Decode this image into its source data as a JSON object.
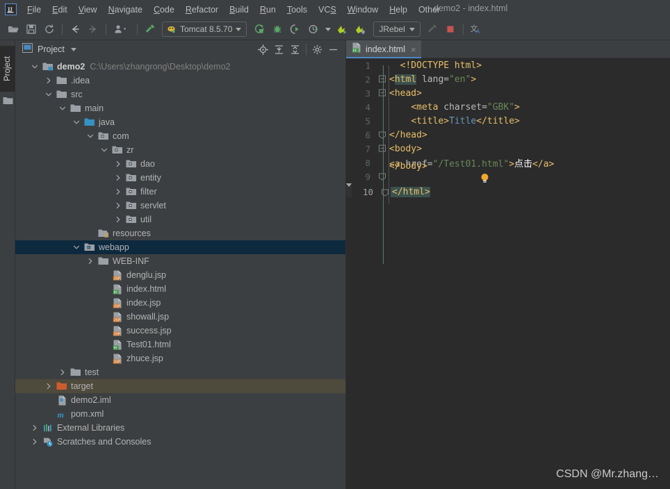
{
  "window": {
    "title": "demo2 - index.html",
    "logo_text": "IJ"
  },
  "menubar": {
    "items": [
      {
        "label": "File",
        "mnemonic": "F"
      },
      {
        "label": "Edit",
        "mnemonic": "E"
      },
      {
        "label": "View",
        "mnemonic": "V"
      },
      {
        "label": "Navigate",
        "mnemonic": "N"
      },
      {
        "label": "Code",
        "mnemonic": "C"
      },
      {
        "label": "Refactor",
        "mnemonic": "R"
      },
      {
        "label": "Build",
        "mnemonic": "B"
      },
      {
        "label": "Run",
        "mnemonic": "R"
      },
      {
        "label": "Tools",
        "mnemonic": "T"
      },
      {
        "label": "VCS",
        "mnemonic": "S"
      },
      {
        "label": "Window",
        "mnemonic": "W"
      },
      {
        "label": "Help",
        "mnemonic": "H"
      },
      {
        "label": "Other",
        "mnemonic": ""
      }
    ]
  },
  "toolbar": {
    "icons": [
      "open-folder-icon",
      "save-all-icon",
      "sync-refresh-icon",
      "navigate-back-icon",
      "navigate-forward-icon",
      "profile-dropdown-icon",
      "build-hammer-icon"
    ],
    "run_config": "Tomcat 8.5.70",
    "run_icons": [
      "run-icon",
      "debug-icon",
      "run-with-coverage-icon",
      "profiler-icon"
    ],
    "jrebel_run_icon": "jrebel-run-icon",
    "jrebel_debug_icon": "jrebel-debug-icon",
    "jrebel_label": "JRebel",
    "stop_icon": "stop-icon",
    "hammer_grey_icon": "hammer-grey-icon",
    "translate_icon": "translate-icon"
  },
  "left_strip": {
    "tool_label": "Project",
    "folder_icon": "folder-icon"
  },
  "project_panel": {
    "title": "Project",
    "buttons": [
      "locate-target-icon",
      "expand-all-icon",
      "collapse-all-icon",
      "settings-gear-icon",
      "hide-panel-icon"
    ],
    "tree": [
      {
        "label": "demo2",
        "path": "C:\\Users\\zhangrong\\Desktop\\demo2",
        "depth": 0,
        "arrow": "down",
        "icon": "module-folder-icon",
        "bold": true,
        "state": "normal"
      },
      {
        "label": ".idea",
        "path": "",
        "depth": 1,
        "arrow": "right",
        "icon": "folder-icon",
        "bold": false,
        "state": "normal"
      },
      {
        "label": "src",
        "path": "",
        "depth": 1,
        "arrow": "down",
        "icon": "folder-icon",
        "bold": false,
        "state": "normal"
      },
      {
        "label": "main",
        "path": "",
        "depth": 2,
        "arrow": "down",
        "icon": "folder-icon",
        "bold": false,
        "state": "normal"
      },
      {
        "label": "java",
        "path": "",
        "depth": 3,
        "arrow": "down",
        "icon": "source-root-icon",
        "bold": false,
        "state": "normal"
      },
      {
        "label": "com",
        "path": "",
        "depth": 4,
        "arrow": "down",
        "icon": "package-icon",
        "bold": false,
        "state": "normal"
      },
      {
        "label": "zr",
        "path": "",
        "depth": 5,
        "arrow": "down",
        "icon": "package-icon",
        "bold": false,
        "state": "normal"
      },
      {
        "label": "dao",
        "path": "",
        "depth": 6,
        "arrow": "right",
        "icon": "package-icon",
        "bold": false,
        "state": "normal"
      },
      {
        "label": "entity",
        "path": "",
        "depth": 6,
        "arrow": "right",
        "icon": "package-icon",
        "bold": false,
        "state": "normal"
      },
      {
        "label": "filter",
        "path": "",
        "depth": 6,
        "arrow": "right",
        "icon": "package-icon",
        "bold": false,
        "state": "normal"
      },
      {
        "label": "servlet",
        "path": "",
        "depth": 6,
        "arrow": "right",
        "icon": "package-icon",
        "bold": false,
        "state": "normal"
      },
      {
        "label": "util",
        "path": "",
        "depth": 6,
        "arrow": "right",
        "icon": "package-icon",
        "bold": false,
        "state": "normal"
      },
      {
        "label": "resources",
        "path": "",
        "depth": 4,
        "arrow": "none",
        "icon": "resources-root-icon",
        "bold": false,
        "state": "normal"
      },
      {
        "label": "webapp",
        "path": "",
        "depth": 3,
        "arrow": "down",
        "icon": "webapp-root-icon",
        "bold": false,
        "state": "selected"
      },
      {
        "label": "WEB-INF",
        "path": "",
        "depth": 4,
        "arrow": "right",
        "icon": "folder-icon",
        "bold": false,
        "state": "normal"
      },
      {
        "label": "denglu.jsp",
        "path": "",
        "depth": 5,
        "arrow": "none",
        "icon": "jsp-file-icon",
        "bold": false,
        "state": "normal"
      },
      {
        "label": "index.html",
        "path": "",
        "depth": 5,
        "arrow": "none",
        "icon": "html-file-icon",
        "bold": false,
        "state": "normal"
      },
      {
        "label": "index.jsp",
        "path": "",
        "depth": 5,
        "arrow": "none",
        "icon": "jsp-file-icon",
        "bold": false,
        "state": "normal"
      },
      {
        "label": "showall.jsp",
        "path": "",
        "depth": 5,
        "arrow": "none",
        "icon": "jsp-file-icon",
        "bold": false,
        "state": "normal"
      },
      {
        "label": "success.jsp",
        "path": "",
        "depth": 5,
        "arrow": "none",
        "icon": "jsp-file-icon",
        "bold": false,
        "state": "normal"
      },
      {
        "label": "Test01.html",
        "path": "",
        "depth": 5,
        "arrow": "none",
        "icon": "html-file-icon",
        "bold": false,
        "state": "normal"
      },
      {
        "label": "zhuce.jsp",
        "path": "",
        "depth": 5,
        "arrow": "none",
        "icon": "jsp-file-icon",
        "bold": false,
        "state": "normal"
      },
      {
        "label": "test",
        "path": "",
        "depth": 2,
        "arrow": "right",
        "icon": "folder-icon",
        "bold": false,
        "state": "normal"
      },
      {
        "label": "target",
        "path": "",
        "depth": 1,
        "arrow": "right",
        "icon": "excluded-folder-icon",
        "bold": false,
        "state": "hover"
      },
      {
        "label": "demo2.iml",
        "path": "",
        "depth": 1,
        "arrow": "none",
        "icon": "iml-file-icon",
        "bold": false,
        "state": "normal"
      },
      {
        "label": "pom.xml",
        "path": "",
        "depth": 1,
        "arrow": "none",
        "icon": "maven-file-icon",
        "bold": false,
        "state": "normal"
      },
      {
        "label": "External Libraries",
        "path": "",
        "depth": 0,
        "arrow": "right",
        "icon": "libraries-icon",
        "bold": false,
        "state": "normal"
      },
      {
        "label": "Scratches and Consoles",
        "path": "",
        "depth": 0,
        "arrow": "right",
        "icon": "scratches-icon",
        "bold": false,
        "state": "normal"
      }
    ]
  },
  "editor": {
    "tab": {
      "label": "index.html",
      "icon": "html-file-icon",
      "close": "×"
    },
    "lines": [
      {
        "num": "1",
        "fold": "none",
        "caret": false,
        "indent": 2
      },
      {
        "num": "2",
        "fold": "open",
        "caret": false,
        "indent": 0
      },
      {
        "num": "3",
        "fold": "open",
        "caret": false,
        "indent": 0
      },
      {
        "num": "4",
        "fold": "none",
        "caret": false,
        "indent": 4
      },
      {
        "num": "5",
        "fold": "none",
        "caret": false,
        "indent": 4
      },
      {
        "num": "6",
        "fold": "close",
        "caret": false,
        "indent": 0
      },
      {
        "num": "7",
        "fold": "open",
        "caret": false,
        "indent": 0
      },
      {
        "num": "8",
        "fold": "none",
        "caret": false,
        "indent": 0
      },
      {
        "num": "9",
        "fold": "close",
        "caret": false,
        "indent": 0
      },
      {
        "num": "10",
        "fold": "close",
        "caret": true,
        "indent": 0
      }
    ],
    "code_text": {
      "l1": "<!DOCTYPE html>",
      "l2_open": "<",
      "l2_tag": "html",
      "l2_attr": " lang=",
      "l2_str": "\"en\"",
      "l2_close": ">",
      "l3": "<head>",
      "l4_open": "<",
      "l4_tag": "meta",
      "l4_attr": " charset=",
      "l4_str": "\"GBK\"",
      "l4_close": ">",
      "l5_open": "<title>",
      "l5_text": "Title",
      "l5_close": "</title>",
      "l6": "</head>",
      "l7": "<body>",
      "l8_open": "<",
      "l8_tag": "a",
      "l8_attr": " href=",
      "l8_str": "\"/Test01.html\"",
      "l8_gt": ">",
      "l8_text": "点击",
      "l8_end": "</a>",
      "l9": "</body>",
      "l10": "</html>"
    },
    "bulb_icon": "intention-bulb-icon"
  },
  "watermark": "CSDN @Mr.zhang…",
  "colors": {
    "accent_blue": "#4a88c7",
    "selection": "#0d293e",
    "hover": "#4e4a3c",
    "bg_panel": "#3c3f41",
    "bg_editor": "#2b2b2b",
    "tag": "#e8bf6a",
    "string": "#6a8759",
    "text": "#a9b7c6"
  }
}
